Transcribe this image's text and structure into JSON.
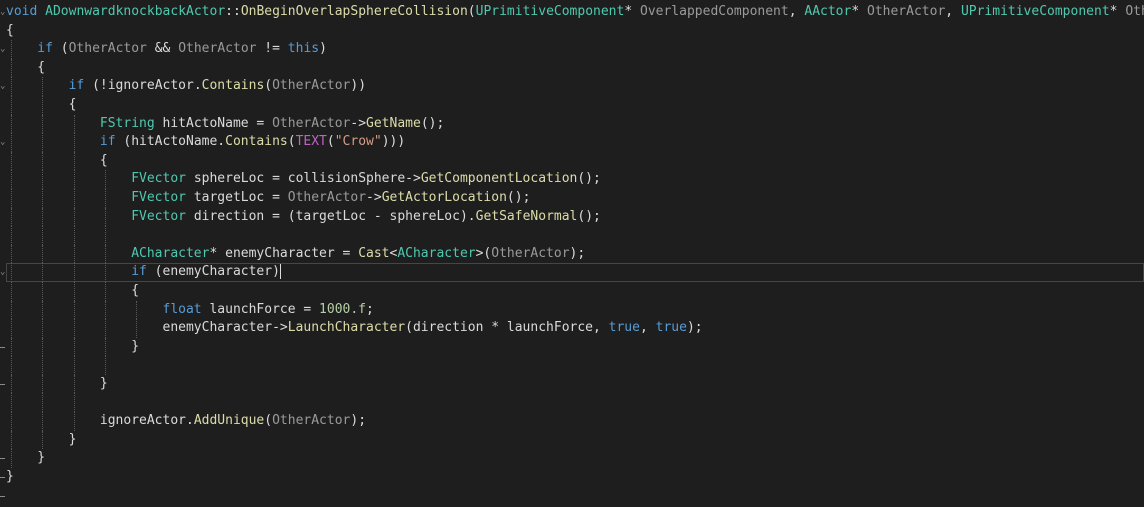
{
  "editor": {
    "lines": [
      {
        "indent": 0,
        "tokens": [
          {
            "t": "void",
            "c": "kw"
          },
          {
            "t": " ",
            "c": "pl"
          },
          {
            "t": "ADownwardknockbackActor",
            "c": "ty"
          },
          {
            "t": "::",
            "c": "pl"
          },
          {
            "t": "OnBeginOverlapSphereCollision",
            "c": "fn"
          },
          {
            "t": "(",
            "c": "pl"
          },
          {
            "t": "UPrimitiveComponent",
            "c": "ty"
          },
          {
            "t": "* ",
            "c": "pl"
          },
          {
            "t": "OverlappedComponent",
            "c": "pm"
          },
          {
            "t": ", ",
            "c": "pl"
          },
          {
            "t": "AActor",
            "c": "ty"
          },
          {
            "t": "* ",
            "c": "pl"
          },
          {
            "t": "OtherActor",
            "c": "pm"
          },
          {
            "t": ", ",
            "c": "pl"
          },
          {
            "t": "UPrimitiveComponent",
            "c": "ty"
          },
          {
            "t": "* ",
            "c": "pl"
          },
          {
            "t": "Oth",
            "c": "pm"
          }
        ]
      },
      {
        "indent": 0,
        "tokens": [
          {
            "t": "{",
            "c": "pl"
          }
        ]
      },
      {
        "indent": 1,
        "tokens": [
          {
            "t": "if",
            "c": "kw"
          },
          {
            "t": " (",
            "c": "pl"
          },
          {
            "t": "OtherActor",
            "c": "pm"
          },
          {
            "t": " && ",
            "c": "pl"
          },
          {
            "t": "OtherActor",
            "c": "pm"
          },
          {
            "t": " != ",
            "c": "pl"
          },
          {
            "t": "this",
            "c": "kw"
          },
          {
            "t": ")",
            "c": "pl"
          }
        ]
      },
      {
        "indent": 1,
        "tokens": [
          {
            "t": "{",
            "c": "pl"
          }
        ]
      },
      {
        "indent": 2,
        "tokens": [
          {
            "t": "if",
            "c": "kw"
          },
          {
            "t": " (!",
            "c": "pl"
          },
          {
            "t": "ignoreActor",
            "c": "va"
          },
          {
            "t": ".",
            "c": "pl"
          },
          {
            "t": "Contains",
            "c": "fn"
          },
          {
            "t": "(",
            "c": "pl"
          },
          {
            "t": "OtherActor",
            "c": "pm"
          },
          {
            "t": "))",
            "c": "pl"
          }
        ]
      },
      {
        "indent": 2,
        "tokens": [
          {
            "t": "{",
            "c": "pl"
          }
        ]
      },
      {
        "indent": 3,
        "tokens": [
          {
            "t": "FString",
            "c": "ty"
          },
          {
            "t": " ",
            "c": "pl"
          },
          {
            "t": "hitActoName",
            "c": "va"
          },
          {
            "t": " = ",
            "c": "pl"
          },
          {
            "t": "OtherActor",
            "c": "pm"
          },
          {
            "t": "->",
            "c": "pl"
          },
          {
            "t": "GetName",
            "c": "fn"
          },
          {
            "t": "();",
            "c": "pl"
          }
        ]
      },
      {
        "indent": 3,
        "tokens": [
          {
            "t": "if",
            "c": "kw"
          },
          {
            "t": " (",
            "c": "pl"
          },
          {
            "t": "hitActoName",
            "c": "va"
          },
          {
            "t": ".",
            "c": "pl"
          },
          {
            "t": "Contains",
            "c": "fn"
          },
          {
            "t": "(",
            "c": "pl"
          },
          {
            "t": "TEXT",
            "c": "mc"
          },
          {
            "t": "(",
            "c": "pl"
          },
          {
            "t": "\"Crow\"",
            "c": "st"
          },
          {
            "t": ")))",
            "c": "pl"
          }
        ]
      },
      {
        "indent": 3,
        "tokens": [
          {
            "t": "{",
            "c": "pl"
          }
        ]
      },
      {
        "indent": 4,
        "tokens": [
          {
            "t": "FVector",
            "c": "ty"
          },
          {
            "t": " ",
            "c": "pl"
          },
          {
            "t": "sphereLoc",
            "c": "va"
          },
          {
            "t": " = ",
            "c": "pl"
          },
          {
            "t": "collisionSphere",
            "c": "va"
          },
          {
            "t": "->",
            "c": "pl"
          },
          {
            "t": "GetComponentLocation",
            "c": "fn"
          },
          {
            "t": "();",
            "c": "pl"
          }
        ]
      },
      {
        "indent": 4,
        "tokens": [
          {
            "t": "FVector",
            "c": "ty"
          },
          {
            "t": " ",
            "c": "pl"
          },
          {
            "t": "targetLoc",
            "c": "va"
          },
          {
            "t": " = ",
            "c": "pl"
          },
          {
            "t": "OtherActor",
            "c": "pm"
          },
          {
            "t": "->",
            "c": "pl"
          },
          {
            "t": "GetActorLocation",
            "c": "fn"
          },
          {
            "t": "();",
            "c": "pl"
          }
        ]
      },
      {
        "indent": 4,
        "tokens": [
          {
            "t": "FVector",
            "c": "ty"
          },
          {
            "t": " ",
            "c": "pl"
          },
          {
            "t": "direction",
            "c": "va"
          },
          {
            "t": " = (",
            "c": "pl"
          },
          {
            "t": "targetLoc",
            "c": "va"
          },
          {
            "t": " - ",
            "c": "pl"
          },
          {
            "t": "sphereLoc",
            "c": "va"
          },
          {
            "t": ").",
            "c": "pl"
          },
          {
            "t": "GetSafeNormal",
            "c": "fn"
          },
          {
            "t": "();",
            "c": "pl"
          }
        ]
      },
      {
        "indent": 4,
        "tokens": []
      },
      {
        "indent": 4,
        "tokens": [
          {
            "t": "ACharacter",
            "c": "ty"
          },
          {
            "t": "* ",
            "c": "pl"
          },
          {
            "t": "enemyCharacter",
            "c": "va"
          },
          {
            "t": " = ",
            "c": "pl"
          },
          {
            "t": "Cast",
            "c": "fn"
          },
          {
            "t": "<",
            "c": "pl"
          },
          {
            "t": "ACharacter",
            "c": "ty"
          },
          {
            "t": ">(",
            "c": "pl"
          },
          {
            "t": "OtherActor",
            "c": "pm"
          },
          {
            "t": ");",
            "c": "pl"
          }
        ]
      },
      {
        "indent": 4,
        "current": true,
        "caret": true,
        "tokens": [
          {
            "t": "if",
            "c": "kw"
          },
          {
            "t": " (",
            "c": "pl"
          },
          {
            "t": "enemyCharacter",
            "c": "va"
          },
          {
            "t": ")",
            "c": "pl"
          }
        ]
      },
      {
        "indent": 4,
        "tokens": [
          {
            "t": "{",
            "c": "pl"
          }
        ]
      },
      {
        "indent": 5,
        "tokens": [
          {
            "t": "float",
            "c": "kw"
          },
          {
            "t": " ",
            "c": "pl"
          },
          {
            "t": "launchForce",
            "c": "va"
          },
          {
            "t": " = ",
            "c": "pl"
          },
          {
            "t": "1000.f",
            "c": "nu"
          },
          {
            "t": ";",
            "c": "pl"
          }
        ]
      },
      {
        "indent": 5,
        "tokens": [
          {
            "t": "enemyCharacter",
            "c": "va"
          },
          {
            "t": "->",
            "c": "pl"
          },
          {
            "t": "LaunchCharacter",
            "c": "fn"
          },
          {
            "t": "(",
            "c": "pl"
          },
          {
            "t": "direction",
            "c": "va"
          },
          {
            "t": " * ",
            "c": "pl"
          },
          {
            "t": "launchForce",
            "c": "va"
          },
          {
            "t": ", ",
            "c": "pl"
          },
          {
            "t": "true",
            "c": "kw"
          },
          {
            "t": ", ",
            "c": "pl"
          },
          {
            "t": "true",
            "c": "kw"
          },
          {
            "t": ");",
            "c": "pl"
          }
        ]
      },
      {
        "indent": 4,
        "tokens": [
          {
            "t": "}",
            "c": "pl"
          }
        ]
      },
      {
        "indent": 4,
        "tokens": []
      },
      {
        "indent": 3,
        "tokens": [
          {
            "t": "}",
            "c": "pl"
          }
        ]
      },
      {
        "indent": 3,
        "tokens": []
      },
      {
        "indent": 3,
        "tokens": [
          {
            "t": "ignoreActor",
            "c": "va"
          },
          {
            "t": ".",
            "c": "pl"
          },
          {
            "t": "AddUnique",
            "c": "fn"
          },
          {
            "t": "(",
            "c": "pl"
          },
          {
            "t": "OtherActor",
            "c": "pm"
          },
          {
            "t": ");",
            "c": "pl"
          }
        ]
      },
      {
        "indent": 2,
        "tokens": [
          {
            "t": "}",
            "c": "pl"
          }
        ]
      },
      {
        "indent": 1,
        "tokens": [
          {
            "t": "}",
            "c": "pl"
          }
        ]
      },
      {
        "indent": 0,
        "tokens": [
          {
            "t": "}",
            "c": "pl"
          }
        ]
      }
    ]
  },
  "colors": {
    "background": "#1e1e1e",
    "keyword": "#569cd6",
    "type": "#4ec9b0",
    "function": "#dcdcaa",
    "parameter": "#9a9a9a",
    "string": "#d69d85",
    "number": "#b5cea8",
    "macro": "#bd63c5",
    "text": "#dcdcdc"
  }
}
